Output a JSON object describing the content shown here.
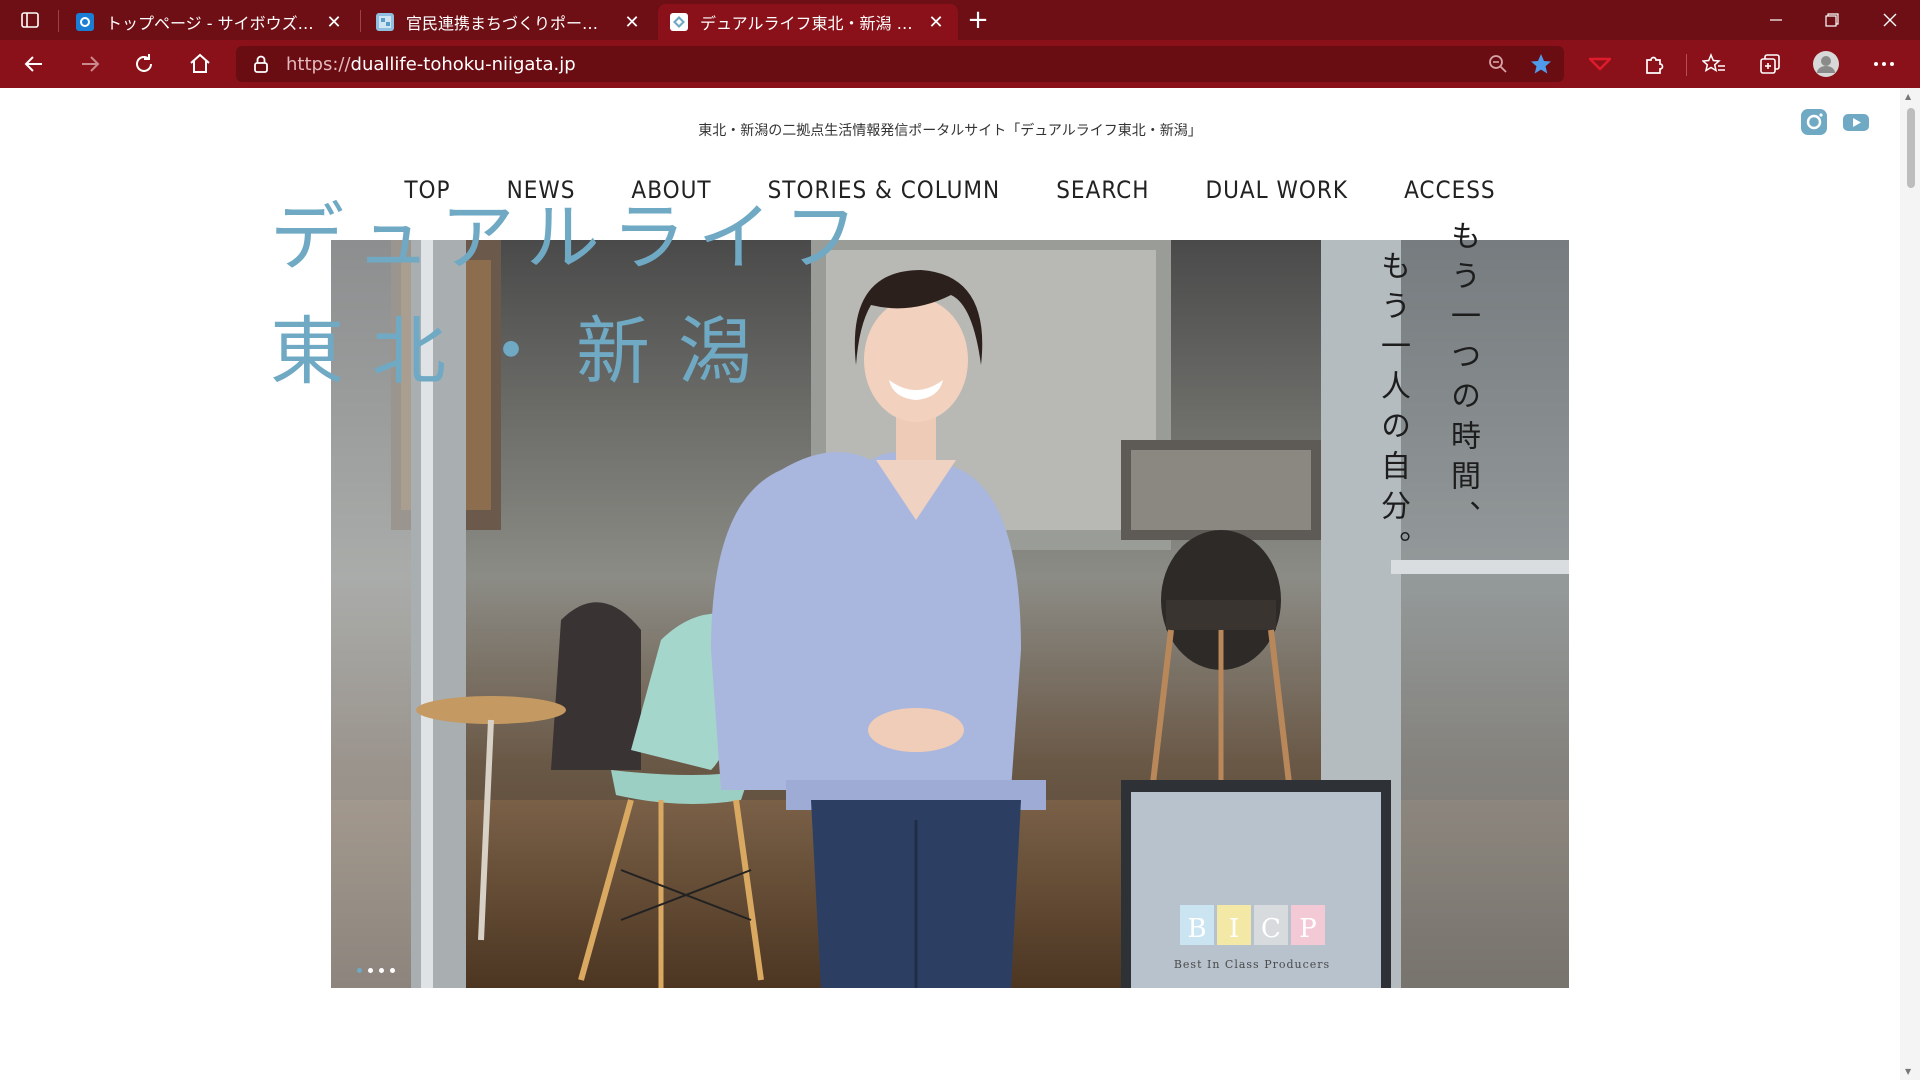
{
  "browser": {
    "tabs": [
      {
        "title": "トップページ - サイボウズ Office",
        "favicon": "cybozu-icon"
      },
      {
        "title": "官民連携まちづくりポータルサイト｜国土交通省",
        "favicon": "portal-icon"
      },
      {
        "title": "デュアルライフ東北・新潟 – 東北・新潟",
        "favicon": "duallife-icon"
      }
    ],
    "url_protocol": "https://",
    "url_host": "duallife-tohoku-niigata.jp",
    "accent_color": "#8a1119"
  },
  "site": {
    "tagline": "東北・新潟の二拠点生活情報発信ポータルサイト「デュアルライフ東北・新潟」",
    "nav": [
      "TOP",
      "NEWS",
      "ABOUT",
      "STORIES & COLUMN",
      "SEARCH",
      "DUAL WORK",
      "ACCESS"
    ],
    "brand_line1": "デュアルライフ",
    "brand_line2": "東北・新潟",
    "vertical_copy_1": "もう一つの時間、",
    "vertical_copy_2": "もう一人の自分。",
    "sign_letters": [
      "B",
      "I",
      "C",
      "P"
    ],
    "sign_caption": "Best In Class Producers",
    "brand_color": "#6fa9c4"
  }
}
